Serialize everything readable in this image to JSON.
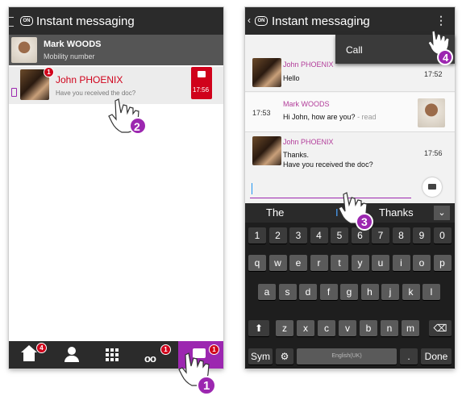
{
  "screen1": {
    "title": "Instant messaging",
    "contact": {
      "name": "Mark WOODS",
      "subtitle": "Mobility number"
    },
    "conversation": {
      "name": "John PHOENIX",
      "preview": "Have you received the doc?",
      "time": "17:56",
      "badge": "1"
    },
    "nav": {
      "home_badge": "4",
      "voicemail_badge": "1",
      "messages_badge": "1"
    },
    "step1": "1",
    "step2": "2"
  },
  "screen2": {
    "title": "Instant messaging",
    "menu_item": "Call",
    "messages": [
      {
        "name": "John PHOENIX",
        "text": "Hello",
        "time": "17:52"
      },
      {
        "name": "Mark WOODS",
        "text": "Hi John, how are you?",
        "status": " - read",
        "time": "17:53"
      },
      {
        "name": "John PHOENIX",
        "text_line1": "Thanks.",
        "text_line2": "Have you received the doc?",
        "time": "17:56"
      }
    ],
    "suggestions": [
      "The",
      "I",
      "Thanks"
    ],
    "keyboard": {
      "row1": [
        "1",
        "2",
        "3",
        "4",
        "5",
        "6",
        "7",
        "8",
        "9",
        "0"
      ],
      "row2": [
        "q",
        "w",
        "e",
        "r",
        "t",
        "y",
        "u",
        "i",
        "o",
        "p"
      ],
      "row3": [
        "a",
        "s",
        "d",
        "f",
        "g",
        "h",
        "j",
        "k",
        "l"
      ],
      "row4": [
        "z",
        "x",
        "c",
        "v",
        "b",
        "n",
        "m"
      ],
      "sym": "Sym",
      "space": "English(UK)",
      "period": ".",
      "done": "Done"
    },
    "step3": "3",
    "step4": "4"
  },
  "colors": {
    "accent": "#9c27b0",
    "bar": "#2b2b2b",
    "badge": "#d0021b",
    "name": "#b23c9a"
  }
}
